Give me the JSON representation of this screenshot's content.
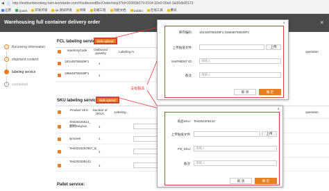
{
  "browser": {
    "url": "http://testtrunkbooking.hart-worldwide.com/#/outboundBoxOrder/step3?id=20380b079-0164-92e0-00a6-3a06db00123",
    "bookmarks": [
      "应用",
      "Quant",
      "开发环境",
      "qa 测试环境",
      "项目",
      "前端工程",
      "功能文档",
      "Dubbo",
      "在线工具",
      "腾讯"
    ]
  },
  "header": {
    "title": "Warehousing full container delivery order",
    "close": "×"
  },
  "steps": [
    {
      "label": "Receiving information",
      "state": "done"
    },
    {
      "label": "shipment content",
      "state": "done"
    },
    {
      "label": "labeling service",
      "state": "active"
    },
    {
      "label": "completed",
      "state": "todo"
    }
  ],
  "fcl": {
    "title": "FCL labeling service:",
    "bulk_label": "Bulk upload",
    "headers": [
      "repertoryCode",
      "Outbound quantity",
      "Labeling m"
    ],
    "rows": [
      {
        "code": "181448755539F1",
        "qty": "1"
      },
      {
        "code": "186648755539F1",
        "qty": "1"
      }
    ]
  },
  "sku": {
    "title": "SKU labeling service:",
    "bulk_label": "Bulk upload",
    "headers": [
      "Product SKU",
      "Number of SKUs",
      "Labeling..."
    ],
    "rows": [
      {
        "sku": "Test20220514_翻制fangzue",
        "qty": "1"
      },
      {
        "sku": "lymore8",
        "qty": "1"
      },
      {
        "sku": "Test3234257557_ty",
        "qty": "1"
      },
      {
        "sku": "Test202205142",
        "qty": "1"
      }
    ]
  },
  "pallet": {
    "title": "Pallet service:"
  },
  "operation_label": "operation",
  "annotation": "没有翻译",
  "modal1": {
    "code_label": "库存编码:",
    "code_value": "181448755539F1,186648755539F1",
    "upload_label": "上传贴纸文件:",
    "upload_btn": "上传",
    "shipment_label": "SHIPMENT ID:",
    "shipment_placeholder": "请输入",
    "remark_label": "备注:",
    "remark_placeholder": "请输入",
    "cancel": "取 消",
    "ok": "确 定"
  },
  "modal2": {
    "sku_label": "商品SKU:",
    "sku_value": "Test202205142",
    "upload_label": "上传贴纸文件:",
    "upload_btn": "上传",
    "fnsku_label": "FN_SKU:",
    "fnsku_placeholder": "请输入",
    "remark_label": "备注:",
    "remark_placeholder": "请输入",
    "cancel": "取 消",
    "ok": "确 定"
  },
  "colors": {
    "accent": "#e67e22",
    "header": "#4a4a4a",
    "annotation": "#e53935"
  }
}
